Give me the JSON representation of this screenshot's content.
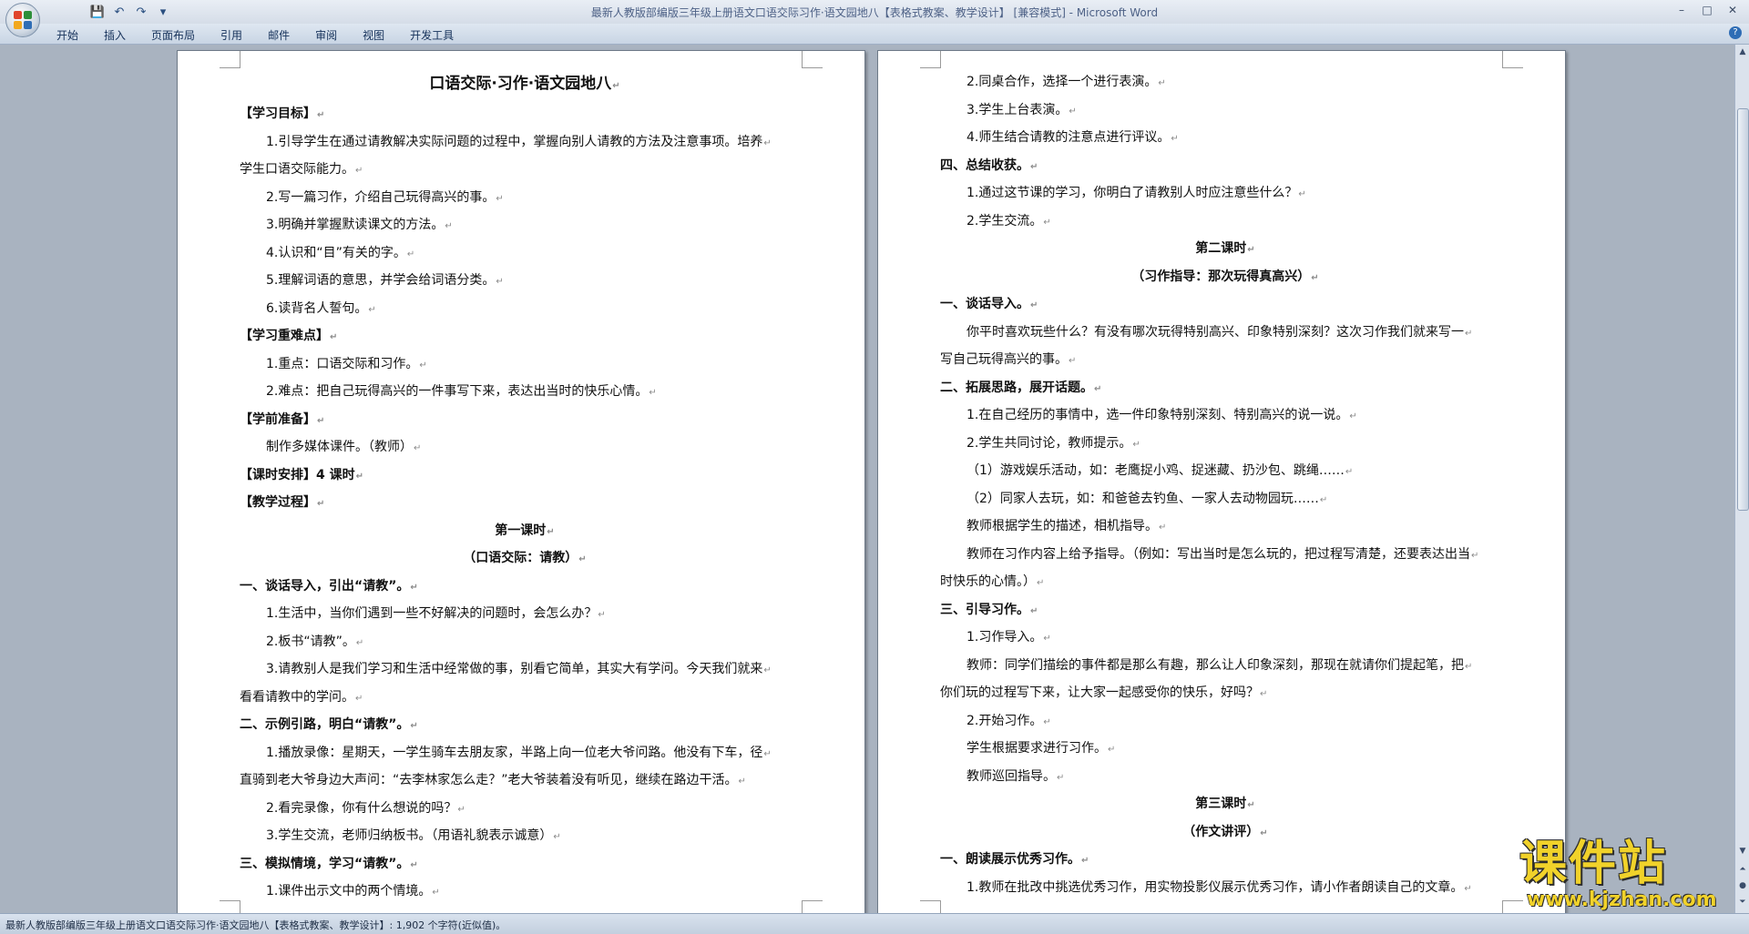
{
  "window": {
    "title": "最新人教版部编版三年级上册语文口语交际习作·语文园地八【表格式教案、教学设计】 [兼容模式] - Microsoft Word",
    "controls": [
      "–",
      "□",
      "✕"
    ]
  },
  "qat": {
    "save_icon": "💾",
    "undo_icon": "↶",
    "redo_icon": "↷",
    "more_icon": "▾"
  },
  "ribbon": {
    "tabs": [
      "开始",
      "插入",
      "页面布局",
      "引用",
      "邮件",
      "审阅",
      "视图",
      "开发工具"
    ],
    "help": "?"
  },
  "colors": {
    "office_logo": [
      "#e0452b",
      "#2c8f3a",
      "#f2a81e",
      "#2f6db5"
    ],
    "watermark": "#f1d22a"
  },
  "left_page": {
    "lines": [
      {
        "text": "口语交际·习作·语文园地八",
        "style": "title"
      },
      {
        "text": "【学习目标】",
        "style": "b"
      },
      {
        "text": "1.引导学生在通过请教解决实际问题的过程中，掌握向别人请教的方法及注意事项。培养",
        "style": "indent"
      },
      {
        "text": "学生口语交际能力。",
        "style": ""
      },
      {
        "text": "2.写一篇习作，介绍自己玩得高兴的事。",
        "style": "indent"
      },
      {
        "text": "3.明确并掌握默读课文的方法。",
        "style": "indent"
      },
      {
        "text": "4.认识和“目”有关的字。",
        "style": "indent"
      },
      {
        "text": "5.理解词语的意思，并学会给词语分类。",
        "style": "indent"
      },
      {
        "text": "6.读背名人誓句。",
        "style": "indent"
      },
      {
        "text": "【学习重难点】",
        "style": "b"
      },
      {
        "text": "1.重点：口语交际和习作。",
        "style": "indent"
      },
      {
        "text": "2.难点：把自己玩得高兴的一件事写下来，表达出当时的快乐心情。",
        "style": "indent"
      },
      {
        "text": "【学前准备】",
        "style": "b"
      },
      {
        "text": "制作多媒体课件。（教师）",
        "style": "indent"
      },
      {
        "text": "【课时安排】4 课时",
        "style": "b"
      },
      {
        "text": "【教学过程】",
        "style": "b"
      },
      {
        "text": "第一课时",
        "style": "center b"
      },
      {
        "text": "（口语交际：请教）",
        "style": "center b"
      },
      {
        "text": "一、谈话导入，引出“请教”。",
        "style": "b"
      },
      {
        "text": "1.生活中，当你们遇到一些不好解决的问题时，会怎么办？",
        "style": "indent"
      },
      {
        "text": "2.板书“请教”。",
        "style": "indent"
      },
      {
        "text": "3.请教别人是我们学习和生活中经常做的事，别看它简单，其实大有学问。今天我们就来",
        "style": "indent"
      },
      {
        "text": "看看请教中的学问。",
        "style": ""
      },
      {
        "text": "二、示例引路，明白“请教”。",
        "style": "b"
      },
      {
        "text": "1.播放录像：星期天，一学生骑车去朋友家，半路上向一位老大爷问路。他没有下车，径",
        "style": "indent"
      },
      {
        "text": "直骑到老大爷身边大声问：“去李林家怎么走？”老大爷装着没有听见，继续在路边干活。",
        "style": ""
      },
      {
        "text": "2.看完录像，你有什么想说的吗？",
        "style": "indent"
      },
      {
        "text": "3.学生交流，老师归纳板书。（用语礼貌表示诚意）",
        "style": "indent"
      },
      {
        "text": "三、模拟情境，学习“请教”。",
        "style": "b"
      },
      {
        "text": "1.课件出示文中的两个情境。",
        "style": "indent"
      }
    ]
  },
  "right_page": {
    "lines": [
      {
        "text": "2.同桌合作，选择一个进行表演。",
        "style": "indent"
      },
      {
        "text": "3.学生上台表演。",
        "style": "indent"
      },
      {
        "text": "4.师生结合请教的注意点进行评议。",
        "style": "indent"
      },
      {
        "text": "四、总结收获。",
        "style": "b"
      },
      {
        "text": "1.通过这节课的学习，你明白了请教别人时应注意些什么？",
        "style": "indent"
      },
      {
        "text": "2.学生交流。",
        "style": "indent"
      },
      {
        "text": "第二课时",
        "style": "center b"
      },
      {
        "text": "（习作指导：那次玩得真高兴）",
        "style": "center b"
      },
      {
        "text": "一、谈话导入。",
        "style": "b"
      },
      {
        "text": "你平时喜欢玩些什么？有没有哪次玩得特别高兴、印象特别深刻？这次习作我们就来写一",
        "style": "indent"
      },
      {
        "text": "写自己玩得高兴的事。",
        "style": ""
      },
      {
        "text": "二、拓展思路，展开话题。",
        "style": "b"
      },
      {
        "text": "1.在自己经历的事情中，选一件印象特别深刻、特别高兴的说一说。",
        "style": "indent"
      },
      {
        "text": "2.学生共同讨论，教师提示。",
        "style": "indent"
      },
      {
        "text": "（1）游戏娱乐活动，如：老鹰捉小鸡、捉迷藏、扔沙包、跳绳……",
        "style": "indent"
      },
      {
        "text": "（2）同家人去玩，如：和爸爸去钓鱼、一家人去动物园玩……",
        "style": "indent"
      },
      {
        "text": "教师根据学生的描述，相机指导。",
        "style": "indent"
      },
      {
        "text": "教师在习作内容上给予指导。（例如：写出当时是怎么玩的，把过程写清楚，还要表达出当",
        "style": "indent"
      },
      {
        "text": "时快乐的心情。）",
        "style": ""
      },
      {
        "text": "三、引导习作。",
        "style": "b"
      },
      {
        "text": "1.习作导入。",
        "style": "indent"
      },
      {
        "text": "教师：同学们描绘的事件都是那么有趣，那么让人印象深刻，那现在就请你们提起笔，把",
        "style": "indent"
      },
      {
        "text": "你们玩的过程写下来，让大家一起感受你的快乐，好吗？",
        "style": ""
      },
      {
        "text": "2.开始习作。",
        "style": "indent"
      },
      {
        "text": "学生根据要求进行习作。",
        "style": "indent"
      },
      {
        "text": "教师巡回指导。",
        "style": "indent"
      },
      {
        "text": "第三课时",
        "style": "center b"
      },
      {
        "text": "（作文讲评）",
        "style": "center b"
      },
      {
        "text": "一、朗读展示优秀习作。",
        "style": "b"
      },
      {
        "text": "1.教师在批改中挑选优秀习作，用实物投影仪展示优秀习作，请小作者朗读自己的文章。",
        "style": "indent"
      }
    ]
  },
  "paragraph_mark": "↵",
  "statusbar": {
    "text": "最新人教版部编版三年级上册语文口语交际习作·语文园地八【表格式教案、教学设计】: 1,902 个字符(近似值)。"
  },
  "watermark": {
    "main": "课件站",
    "url": "www.kjzhan.com"
  }
}
